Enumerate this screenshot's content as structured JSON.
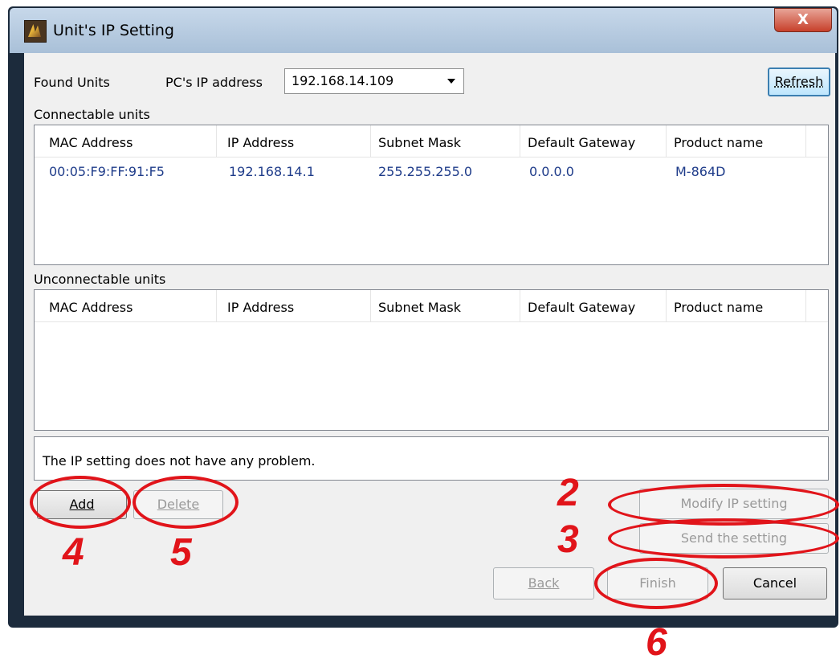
{
  "window": {
    "title": "Unit's IP Setting",
    "close_label": "X"
  },
  "top": {
    "found_units_label": "Found Units",
    "pc_ip_label": "PC's IP address",
    "pc_ip_value": "192.168.14.109",
    "refresh_label": "Refresh"
  },
  "connectable": {
    "label": "Connectable units",
    "columns": [
      "MAC Address",
      "IP Address",
      "Subnet Mask",
      "Default Gateway",
      "Product name"
    ],
    "rows": [
      [
        "00:05:F9:FF:91:F5",
        "192.168.14.1",
        "255.255.255.0",
        "0.0.0.0",
        "M-864D"
      ]
    ]
  },
  "unconnectable": {
    "label": "Unconnectable units",
    "columns": [
      "MAC Address",
      "IP Address",
      "Subnet Mask",
      "Default Gateway",
      "Product name"
    ]
  },
  "status_message": "The IP setting does not have any problem.",
  "buttons": {
    "add": "Add",
    "delete": "Delete",
    "modify": "Modify IP setting",
    "send": "Send the setting",
    "back": "Back",
    "finish": "Finish",
    "cancel": "Cancel"
  },
  "annotations": [
    "2",
    "3",
    "4",
    "5",
    "6"
  ],
  "colors": {
    "annotation": "#e1141a",
    "cell_text": "#1f3c8a"
  }
}
